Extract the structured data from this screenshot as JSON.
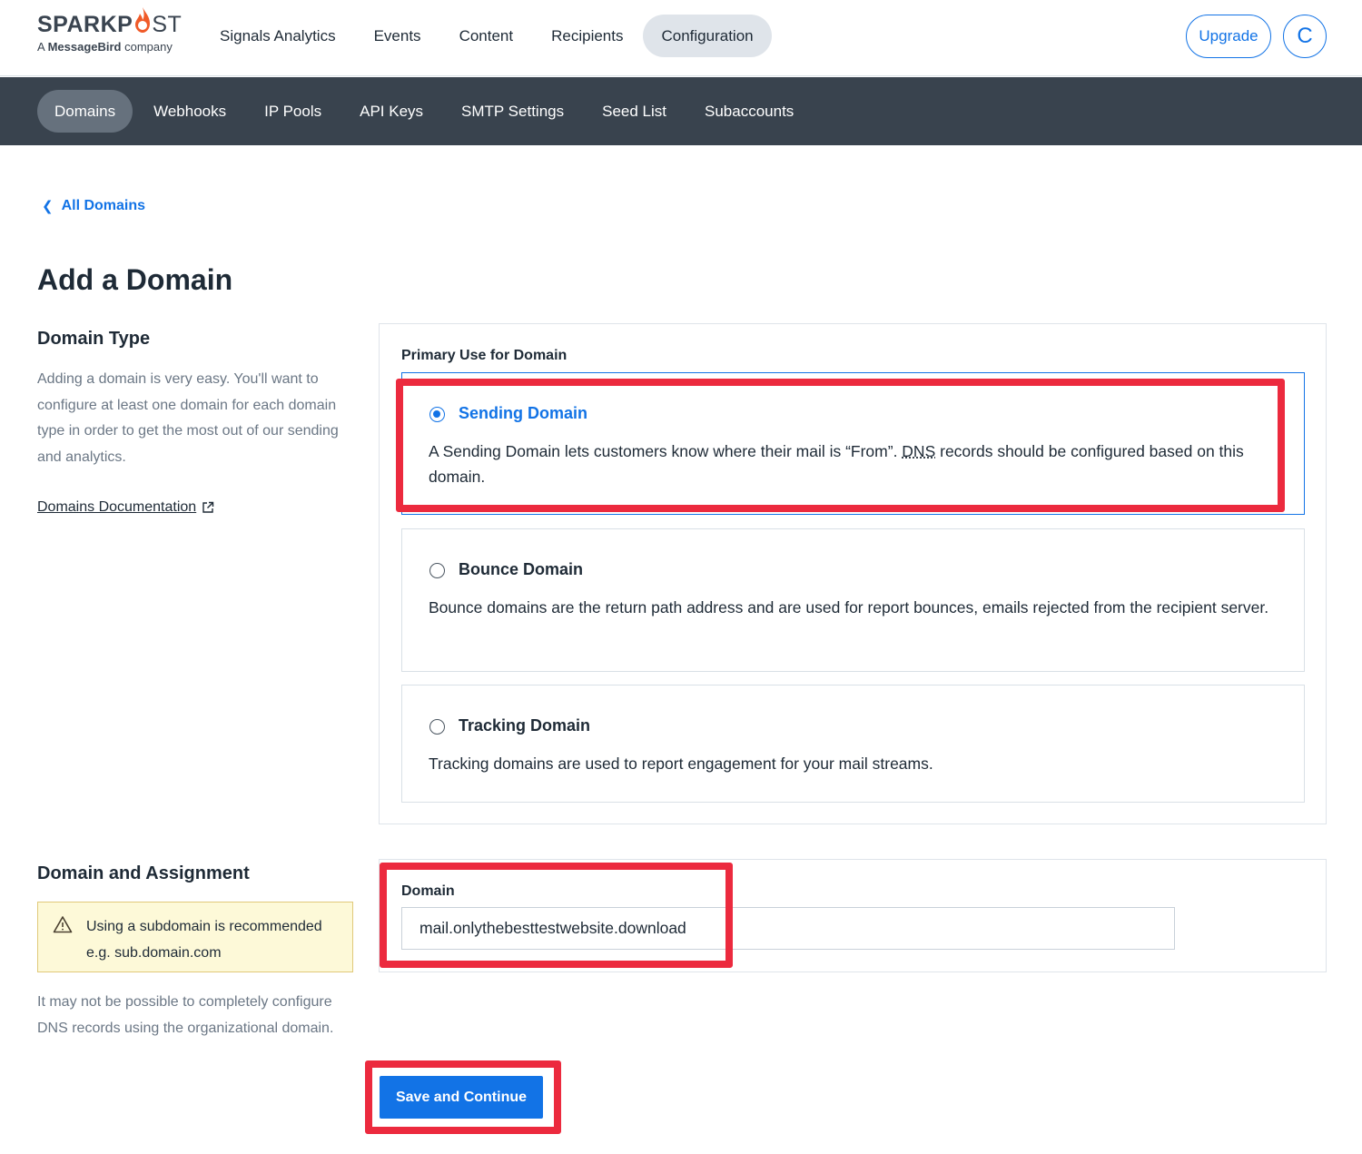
{
  "brand": {
    "name_bold": "SPARKP",
    "name_light": "ST",
    "sub_prefix": "A ",
    "sub_bold": "MessageBird",
    "sub_suffix": " company"
  },
  "topnav": {
    "items": [
      {
        "label": "Signals Analytics"
      },
      {
        "label": "Events"
      },
      {
        "label": "Content"
      },
      {
        "label": "Recipients"
      },
      {
        "label": "Configuration"
      }
    ],
    "active": "Configuration",
    "upgrade_label": "Upgrade",
    "avatar_initial": "C"
  },
  "subnav": {
    "items": [
      {
        "label": "Domains"
      },
      {
        "label": "Webhooks"
      },
      {
        "label": "IP Pools"
      },
      {
        "label": "API Keys"
      },
      {
        "label": "SMTP Settings"
      },
      {
        "label": "Seed List"
      },
      {
        "label": "Subaccounts"
      }
    ],
    "active": "Domains"
  },
  "breadcrumb": {
    "back_label": "All Domains"
  },
  "page": {
    "title": "Add a Domain"
  },
  "domain_type": {
    "title": "Domain Type",
    "help": "Adding a domain is very easy. You'll want to configure at least one domain for each domain type in order to get the most out of our sending and analytics.",
    "doc_link": "Domains Documentation",
    "primary_use_label": "Primary Use for Domain",
    "options": [
      {
        "title": "Sending Domain",
        "desc_before": "A Sending Domain lets customers know where their mail is “From”. ",
        "desc_abbr": "DNS",
        "desc_after": " records should be configured based on this domain.",
        "selected": true
      },
      {
        "title": "Bounce Domain",
        "desc": "Bounce domains are the return path address and are used for report bounces, emails rejected from the recipient server.",
        "selected": false
      },
      {
        "title": "Tracking Domain",
        "desc": "Tracking domains are used to report engagement for your mail streams.",
        "selected": false
      }
    ]
  },
  "assignment": {
    "title": "Domain and Assignment",
    "warning_line1": "Using a subdomain is recommended",
    "warning_line2": "e.g. sub.domain.com",
    "note": "It may not be possible to completely configure DNS records using the organizational domain.",
    "domain_label": "Domain",
    "domain_value": "mail.onlythebesttestwebsite.download"
  },
  "actions": {
    "save_label": "Save and Continue"
  },
  "colors": {
    "accent": "#1273e6",
    "subnav_bg": "#39434e",
    "annotation": "#ec2a3e",
    "warning_bg": "#fdf9d8"
  }
}
